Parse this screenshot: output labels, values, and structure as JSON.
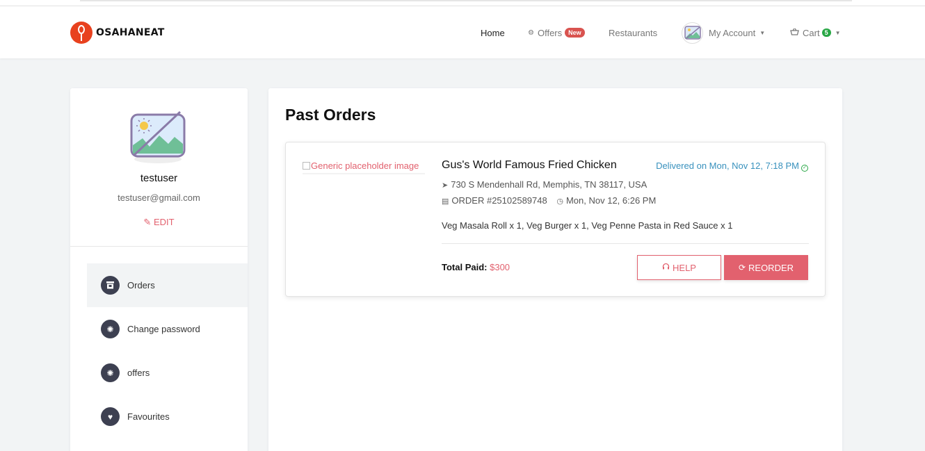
{
  "brand": {
    "name": "OSAHANEAT"
  },
  "nav": {
    "home": "Home",
    "offers": "Offers",
    "offers_badge": "New",
    "restaurants": "Restaurants",
    "account": "My Account",
    "cart": "Cart",
    "cart_count": "5"
  },
  "profile": {
    "username": "testuser",
    "email": "testuser@gmail.com",
    "edit_label": "EDIT"
  },
  "sidebar": {
    "items": [
      {
        "label": "Orders",
        "icon": "food-icon",
        "active": true
      },
      {
        "label": "Change password",
        "icon": "discount-icon"
      },
      {
        "label": "offers",
        "icon": "discount-icon"
      },
      {
        "label": "Favourites",
        "icon": "heart-icon"
      }
    ]
  },
  "main": {
    "title": "Past Orders",
    "order": {
      "image_alt": "Generic placeholder image",
      "restaurant": "Gus's World Famous Fried Chicken",
      "status": "Delivered on Mon, Nov 12, 7:18 PM",
      "address": "730 S Mendenhall Rd, Memphis, TN 38117, USA",
      "order_number": "ORDER #25102589748",
      "order_time": "Mon, Nov 12, 6:26 PM",
      "items": "Veg Masala Roll x 1, Veg Burger x 1, Veg Penne Pasta in Red Sauce x 1",
      "total_label": "Total Paid:",
      "total_amount": "$300",
      "help_label": "HELP",
      "reorder_label": "REORDER"
    }
  },
  "colors": {
    "accent": "#e2616e",
    "brand": "#e8411e",
    "status": "#3891bd",
    "badge_green": "#28a745",
    "icon_dark": "#3d4051"
  }
}
